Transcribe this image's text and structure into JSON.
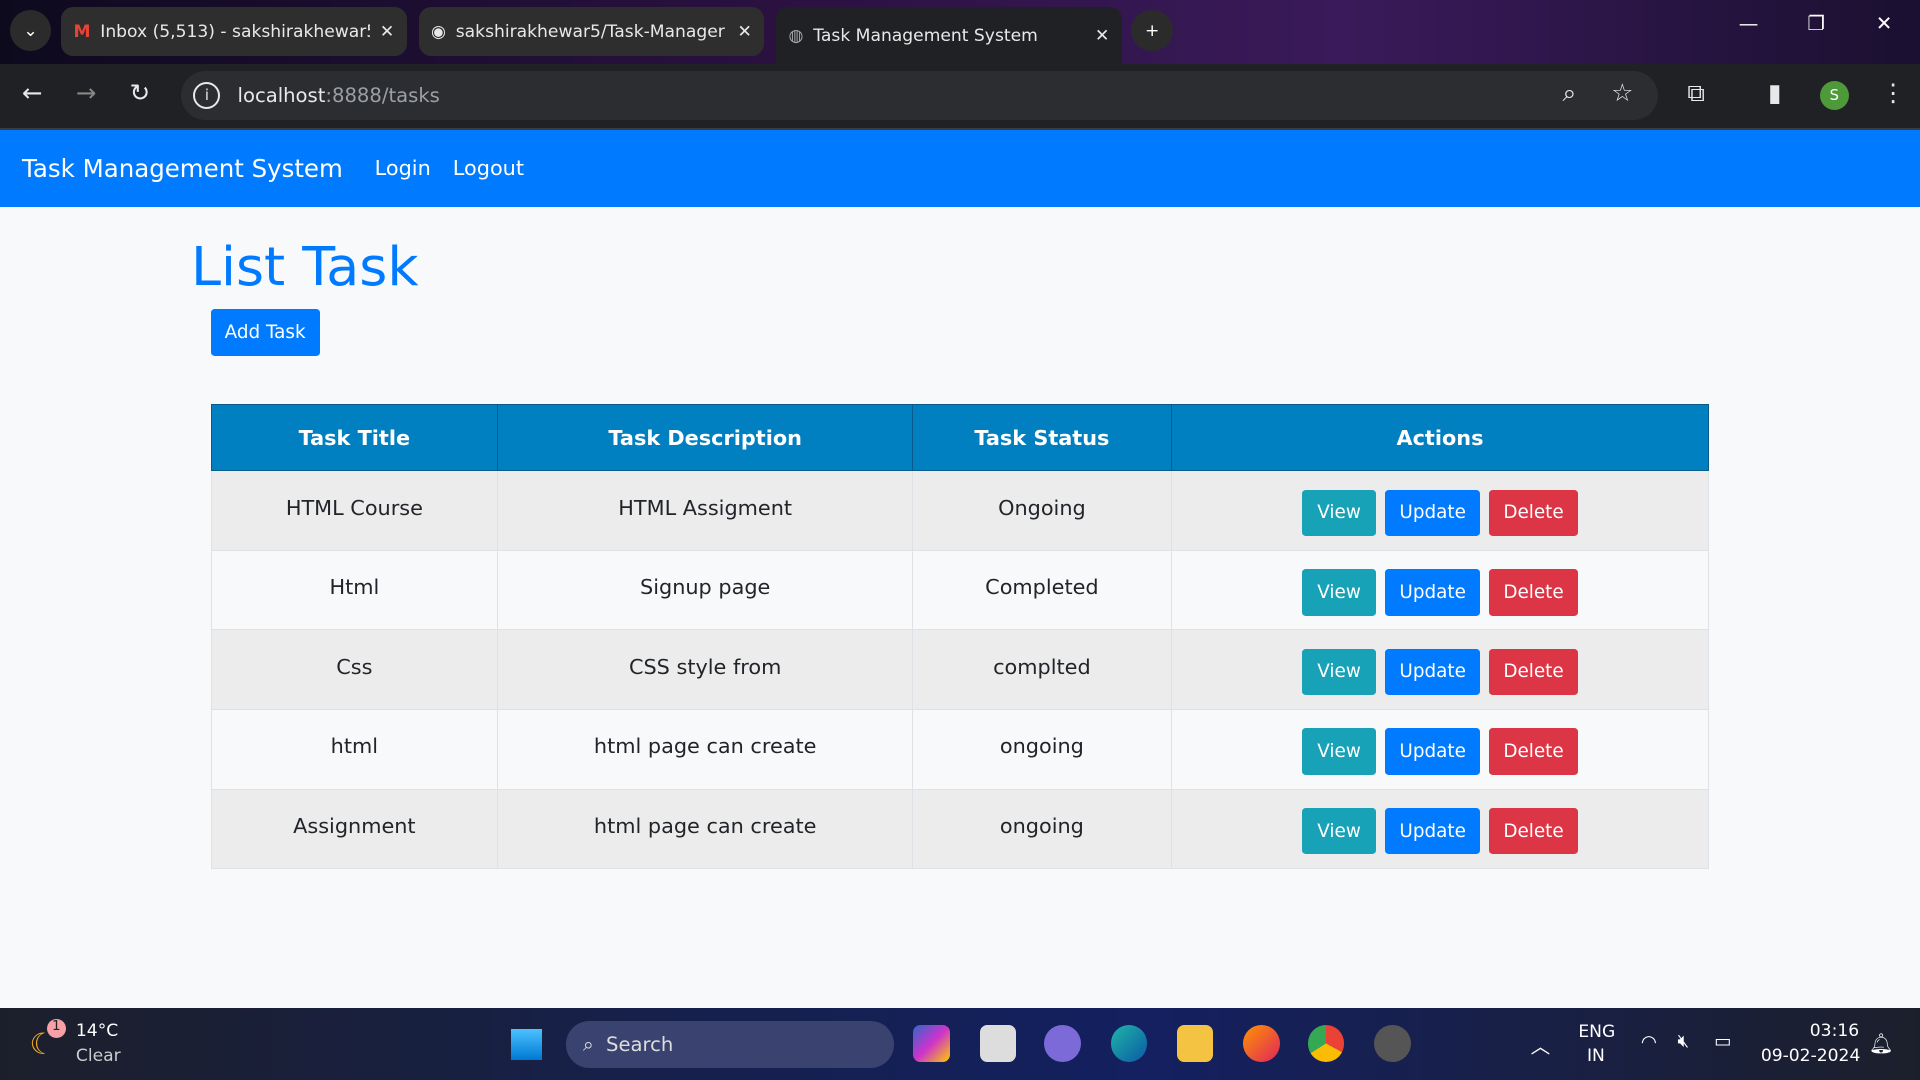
{
  "browser": {
    "tabs": [
      {
        "title": "Inbox (5,513) - sakshirakhewar5",
        "icon": "gmail-icon"
      },
      {
        "title": "sakshirakhewar5/Task-Manager",
        "icon": "github-icon"
      },
      {
        "title": "Task Management System",
        "icon": "globe-icon",
        "active": true
      }
    ],
    "url_host": "localhost",
    "url_rest": ":8888/tasks",
    "profile_initial": "S"
  },
  "nav": {
    "brand": "Task Management System",
    "links": [
      "Login",
      "Logout"
    ]
  },
  "main": {
    "title": "List Task",
    "add_label": "Add Task",
    "columns": [
      "Task Title",
      "Task Description",
      "Task Status",
      "Actions"
    ],
    "rows": [
      {
        "title": "HTML Course",
        "description": "HTML Assigment",
        "status": "Ongoing"
      },
      {
        "title": "Html",
        "description": "Signup page",
        "status": "Completed"
      },
      {
        "title": "Css",
        "description": "CSS style from",
        "status": "complted"
      },
      {
        "title": "html",
        "description": "html page can create",
        "status": "ongoing"
      },
      {
        "title": "Assignment",
        "description": "html page can create",
        "status": "ongoing"
      }
    ],
    "actions": {
      "view": "View",
      "update": "Update",
      "delete": "Delete"
    }
  },
  "taskbar": {
    "weather_temp": "14°C",
    "weather_desc": "Clear",
    "weather_badge": "1",
    "search": "Search",
    "lang1": "ENG",
    "lang2": "IN",
    "time": "03:16",
    "date": "09-02-2024"
  },
  "colors": {
    "primary": "#007bff",
    "info": "#17a2b8",
    "danger": "#dc3545",
    "table_header": "#0080c0"
  }
}
